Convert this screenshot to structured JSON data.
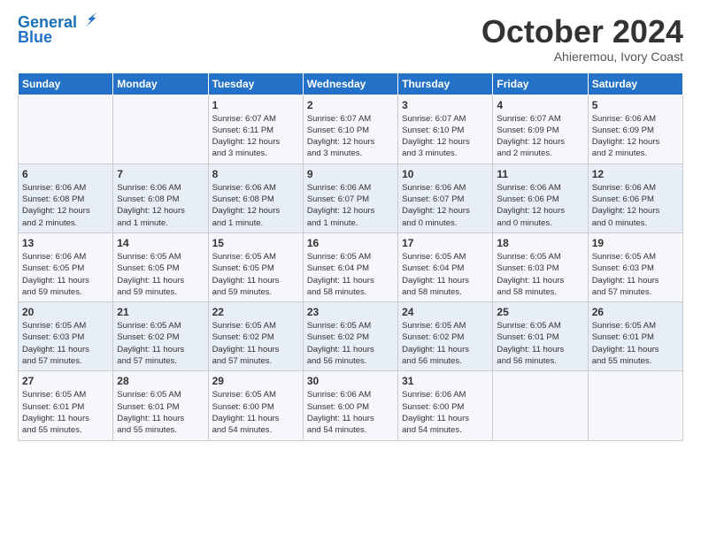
{
  "header": {
    "logo_line1": "General",
    "logo_line2": "Blue",
    "month": "October 2024",
    "location": "Ahieremou, Ivory Coast"
  },
  "weekdays": [
    "Sunday",
    "Monday",
    "Tuesday",
    "Wednesday",
    "Thursday",
    "Friday",
    "Saturday"
  ],
  "weeks": [
    [
      {
        "day": "",
        "info": ""
      },
      {
        "day": "",
        "info": ""
      },
      {
        "day": "1",
        "info": "Sunrise: 6:07 AM\nSunset: 6:11 PM\nDaylight: 12 hours\nand 3 minutes."
      },
      {
        "day": "2",
        "info": "Sunrise: 6:07 AM\nSunset: 6:10 PM\nDaylight: 12 hours\nand 3 minutes."
      },
      {
        "day": "3",
        "info": "Sunrise: 6:07 AM\nSunset: 6:10 PM\nDaylight: 12 hours\nand 3 minutes."
      },
      {
        "day": "4",
        "info": "Sunrise: 6:07 AM\nSunset: 6:09 PM\nDaylight: 12 hours\nand 2 minutes."
      },
      {
        "day": "5",
        "info": "Sunrise: 6:06 AM\nSunset: 6:09 PM\nDaylight: 12 hours\nand 2 minutes."
      }
    ],
    [
      {
        "day": "6",
        "info": "Sunrise: 6:06 AM\nSunset: 6:08 PM\nDaylight: 12 hours\nand 2 minutes."
      },
      {
        "day": "7",
        "info": "Sunrise: 6:06 AM\nSunset: 6:08 PM\nDaylight: 12 hours\nand 1 minute."
      },
      {
        "day": "8",
        "info": "Sunrise: 6:06 AM\nSunset: 6:08 PM\nDaylight: 12 hours\nand 1 minute."
      },
      {
        "day": "9",
        "info": "Sunrise: 6:06 AM\nSunset: 6:07 PM\nDaylight: 12 hours\nand 1 minute."
      },
      {
        "day": "10",
        "info": "Sunrise: 6:06 AM\nSunset: 6:07 PM\nDaylight: 12 hours\nand 0 minutes."
      },
      {
        "day": "11",
        "info": "Sunrise: 6:06 AM\nSunset: 6:06 PM\nDaylight: 12 hours\nand 0 minutes."
      },
      {
        "day": "12",
        "info": "Sunrise: 6:06 AM\nSunset: 6:06 PM\nDaylight: 12 hours\nand 0 minutes."
      }
    ],
    [
      {
        "day": "13",
        "info": "Sunrise: 6:06 AM\nSunset: 6:05 PM\nDaylight: 11 hours\nand 59 minutes."
      },
      {
        "day": "14",
        "info": "Sunrise: 6:05 AM\nSunset: 6:05 PM\nDaylight: 11 hours\nand 59 minutes."
      },
      {
        "day": "15",
        "info": "Sunrise: 6:05 AM\nSunset: 6:05 PM\nDaylight: 11 hours\nand 59 minutes."
      },
      {
        "day": "16",
        "info": "Sunrise: 6:05 AM\nSunset: 6:04 PM\nDaylight: 11 hours\nand 58 minutes."
      },
      {
        "day": "17",
        "info": "Sunrise: 6:05 AM\nSunset: 6:04 PM\nDaylight: 11 hours\nand 58 minutes."
      },
      {
        "day": "18",
        "info": "Sunrise: 6:05 AM\nSunset: 6:03 PM\nDaylight: 11 hours\nand 58 minutes."
      },
      {
        "day": "19",
        "info": "Sunrise: 6:05 AM\nSunset: 6:03 PM\nDaylight: 11 hours\nand 57 minutes."
      }
    ],
    [
      {
        "day": "20",
        "info": "Sunrise: 6:05 AM\nSunset: 6:03 PM\nDaylight: 11 hours\nand 57 minutes."
      },
      {
        "day": "21",
        "info": "Sunrise: 6:05 AM\nSunset: 6:02 PM\nDaylight: 11 hours\nand 57 minutes."
      },
      {
        "day": "22",
        "info": "Sunrise: 6:05 AM\nSunset: 6:02 PM\nDaylight: 11 hours\nand 57 minutes."
      },
      {
        "day": "23",
        "info": "Sunrise: 6:05 AM\nSunset: 6:02 PM\nDaylight: 11 hours\nand 56 minutes."
      },
      {
        "day": "24",
        "info": "Sunrise: 6:05 AM\nSunset: 6:02 PM\nDaylight: 11 hours\nand 56 minutes."
      },
      {
        "day": "25",
        "info": "Sunrise: 6:05 AM\nSunset: 6:01 PM\nDaylight: 11 hours\nand 56 minutes."
      },
      {
        "day": "26",
        "info": "Sunrise: 6:05 AM\nSunset: 6:01 PM\nDaylight: 11 hours\nand 55 minutes."
      }
    ],
    [
      {
        "day": "27",
        "info": "Sunrise: 6:05 AM\nSunset: 6:01 PM\nDaylight: 11 hours\nand 55 minutes."
      },
      {
        "day": "28",
        "info": "Sunrise: 6:05 AM\nSunset: 6:01 PM\nDaylight: 11 hours\nand 55 minutes."
      },
      {
        "day": "29",
        "info": "Sunrise: 6:05 AM\nSunset: 6:00 PM\nDaylight: 11 hours\nand 54 minutes."
      },
      {
        "day": "30",
        "info": "Sunrise: 6:06 AM\nSunset: 6:00 PM\nDaylight: 11 hours\nand 54 minutes."
      },
      {
        "day": "31",
        "info": "Sunrise: 6:06 AM\nSunset: 6:00 PM\nDaylight: 11 hours\nand 54 minutes."
      },
      {
        "day": "",
        "info": ""
      },
      {
        "day": "",
        "info": ""
      }
    ]
  ]
}
